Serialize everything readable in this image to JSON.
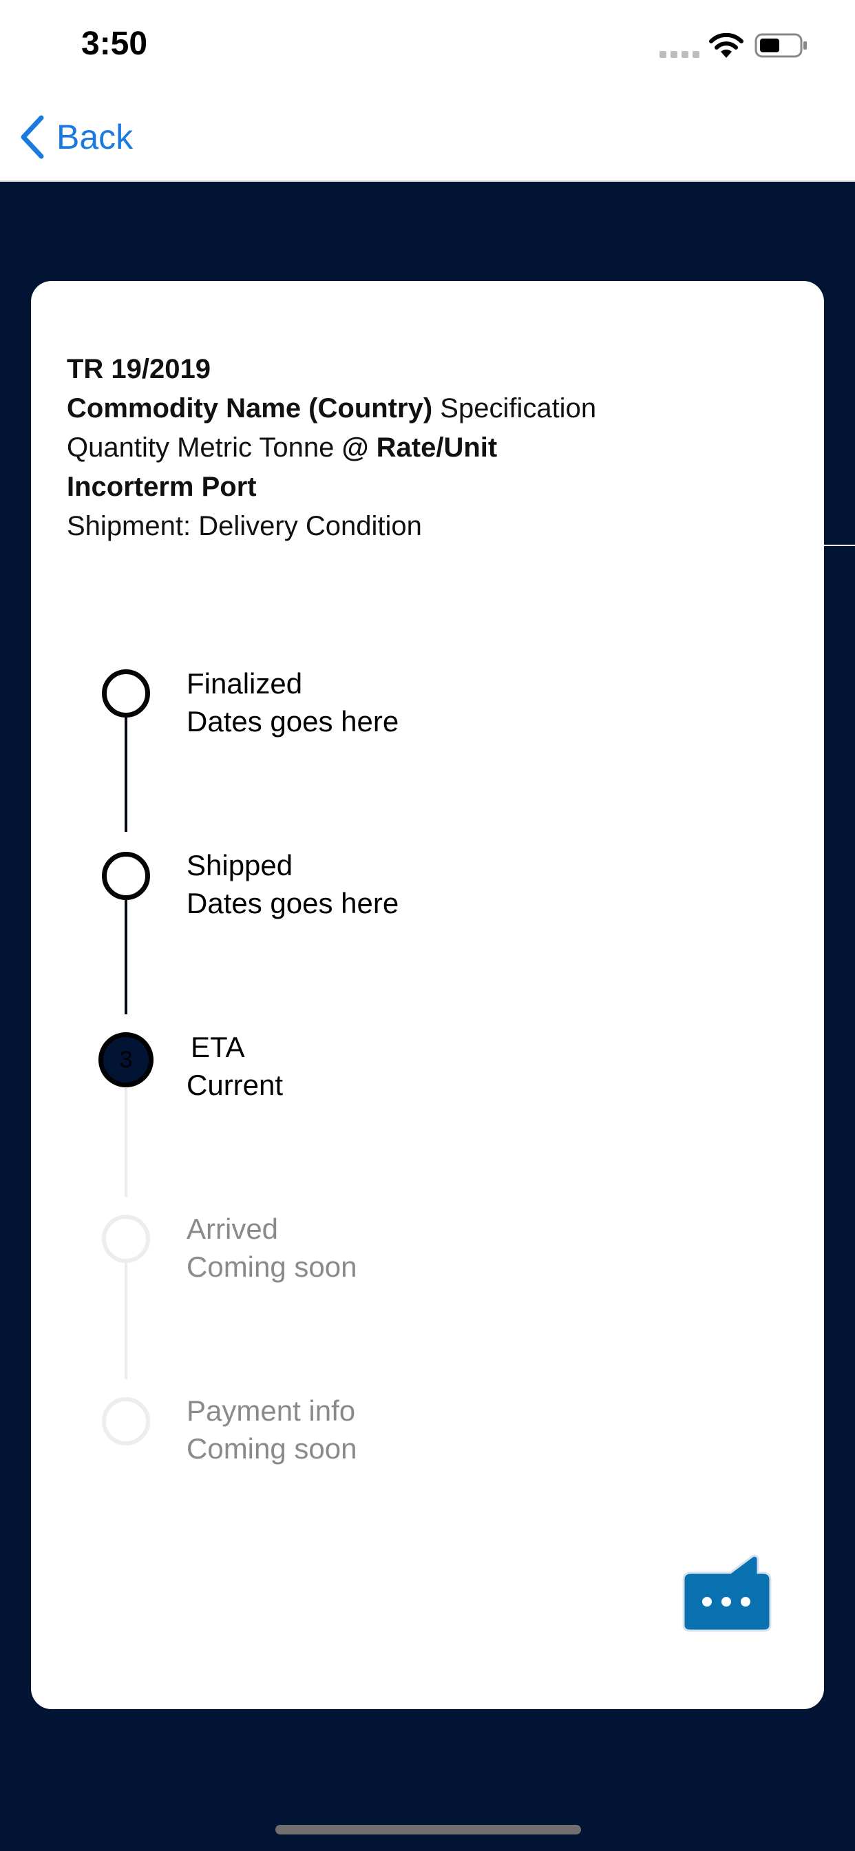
{
  "status_bar": {
    "time": "3:50"
  },
  "nav": {
    "back_label": "Back"
  },
  "contract": {
    "reference": "TR 19/2019",
    "commodity": "Commodity Name (Country)",
    "specification": "Specification",
    "quantity": "Quantity",
    "unit": "Metric Tonne",
    "rate_prefix": "@",
    "rate": "Rate/Unit",
    "incoterm": "Incorterm",
    "port": "Port",
    "shipment_label": "Shipment:",
    "delivery_condition": "Delivery Condition"
  },
  "timeline": {
    "steps": [
      {
        "title": "Finalized",
        "subtitle": "Dates goes here",
        "state": "done"
      },
      {
        "title": "Shipped",
        "subtitle": "Dates goes here",
        "state": "done"
      },
      {
        "number": "3",
        "title": "ETA",
        "subtitle": "Current",
        "state": "current"
      },
      {
        "title": "Arrived",
        "subtitle": "Coming soon",
        "state": "pending"
      },
      {
        "title": "Payment info",
        "subtitle": "Coming soon",
        "state": "pending"
      }
    ]
  },
  "icons": {
    "chat": "chat-bubble-icon",
    "back": "chevron-left-icon"
  },
  "colors": {
    "background": "#021433",
    "accent": "#1a7ae0",
    "chat_button": "#0a71b0",
    "muted_text": "#8a8a8a"
  }
}
